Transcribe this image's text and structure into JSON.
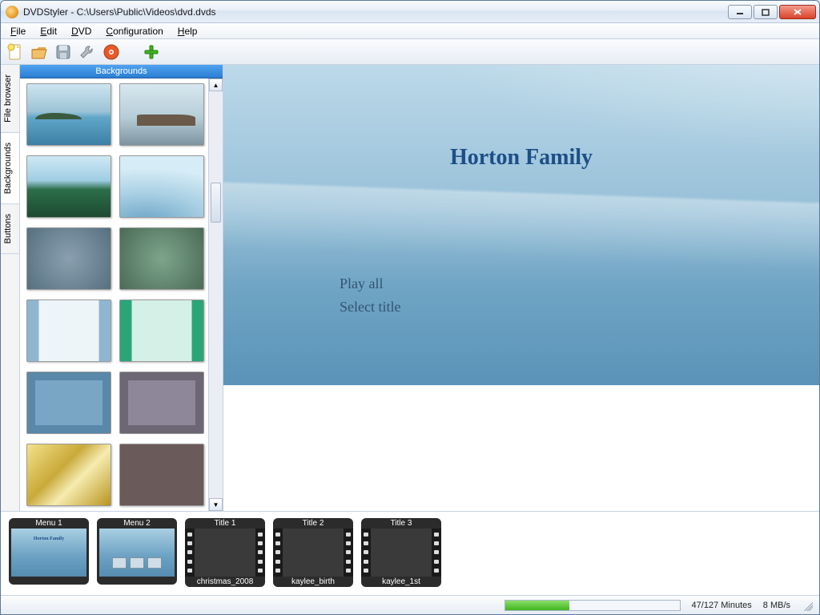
{
  "titlebar": {
    "title": "DVDStyler - C:\\Users\\Public\\Videos\\dvd.dvds"
  },
  "menus": {
    "file": "File",
    "edit": "Edit",
    "dvd": "DVD",
    "configuration": "Configuration",
    "help": "Help"
  },
  "side_tabs": {
    "filebrowser": "File browser",
    "backgrounds": "Backgrounds",
    "buttons": "Buttons"
  },
  "panel": {
    "header": "Backgrounds"
  },
  "preview": {
    "title": "Horton Family",
    "play_all": "Play all",
    "select_title": "Select title"
  },
  "storyboard": {
    "menu1": "Menu 1",
    "menu2": "Menu 2",
    "title1": {
      "top": "Title 1",
      "bottom": "christmas_2008"
    },
    "title2": {
      "top": "Title 2",
      "bottom": "kaylee_birth"
    },
    "title3": {
      "top": "Title 3",
      "bottom": "kaylee_1st"
    }
  },
  "status": {
    "minutes": "47/127 Minutes",
    "bitrate": "8 MB/s"
  }
}
